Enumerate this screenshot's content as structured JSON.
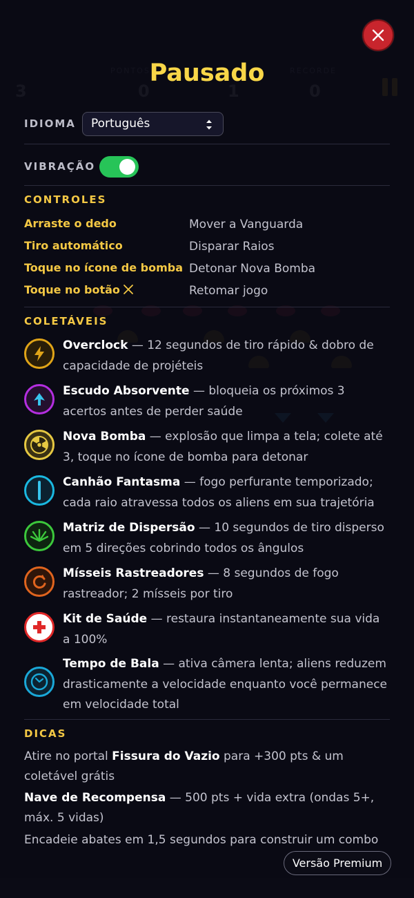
{
  "hud": {
    "lives": "3",
    "score": "0",
    "wave": "1",
    "combo": "0",
    "label_score": "PONTOS",
    "label_combo": "RECORDE"
  },
  "modal": {
    "title": "Pausado",
    "close_icon": "close-icon"
  },
  "language": {
    "label": "IDIOMA",
    "selected": "Português"
  },
  "vibration": {
    "label": "VIBRAÇÃO",
    "enabled": true
  },
  "controls": {
    "heading": "CONTROLES",
    "rows": [
      {
        "key": "Arraste o dedo",
        "action": "Mover a Vanguarda"
      },
      {
        "key": "Tiro automático",
        "action": "Disparar Raios"
      },
      {
        "key": "Toque no ícone de bomba",
        "action": "Detonar Nova Bomba"
      },
      {
        "key": "Toque no botão",
        "action": "Retomar jogo"
      }
    ]
  },
  "collectibles": {
    "heading": "COLETÁVEIS",
    "items": [
      {
        "name": "Overclock",
        "desc": " — 12 segundos de tiro rápido & dobro de capacidade de projéteis",
        "icon": "lightning-icon",
        "color": "#e0a418"
      },
      {
        "name": "Escudo Absorvente",
        "desc": " — bloqueia os próximos 3 acertos antes de perder saúde",
        "icon": "shield-icon",
        "color": "#b42ee0"
      },
      {
        "name": "Nova Bomba",
        "desc": " — explosão que limpa a tela; colete até 3, toque no ícone de bomba para detonar",
        "icon": "radiation-icon",
        "color": "#e6c842"
      },
      {
        "name": "Canhão Fantasma",
        "desc": " — fogo perfurante temporizado; cada raio atravessa todos os aliens em sua trajetória",
        "icon": "beam-icon",
        "color": "#1ab8e0"
      },
      {
        "name": "Matriz de Dispersão",
        "desc": " — 10 segundos de tiro disperso em 5 direções cobrindo todos os ângulos",
        "icon": "spread-icon",
        "color": "#3cc83c"
      },
      {
        "name": "Mísseis Rastreadores",
        "desc": " — 8 segundos de fogo rastreador; 2 mísseis por tiro",
        "icon": "homing-missile-icon",
        "color": "#e0641e"
      },
      {
        "name": "Kit de Saúde",
        "desc": " — restaura instantaneamente sua vida a 100%",
        "icon": "health-cross-icon",
        "color": "#e02828"
      },
      {
        "name": "Tempo de Bala",
        "desc": " — ativa câmera lenta; aliens reduzem drasticamente a velocidade enquanto você permanece em velocidade total",
        "icon": "clock-icon",
        "color": "#1aa8d8"
      }
    ]
  },
  "tips": {
    "heading": "DICAS",
    "lines": [
      {
        "pre": "Atire no portal ",
        "bold": "Fissura do Vazio",
        "post": " para +300 pts & um coletável grátis"
      },
      {
        "pre": "",
        "bold": "Nave de Recompensa",
        "post": " — 500 pts + vida extra (ondas 5+, máx. 5 vidas)"
      },
      {
        "pre": "Encadeie abates em 1,5 segundos para construir um combo",
        "bold": "",
        "post": ""
      }
    ]
  },
  "premium": {
    "label": "Versão Premium"
  },
  "colors": {
    "accent": "#f4c844",
    "toggle_on": "#27c458",
    "close": "#c8252d"
  }
}
